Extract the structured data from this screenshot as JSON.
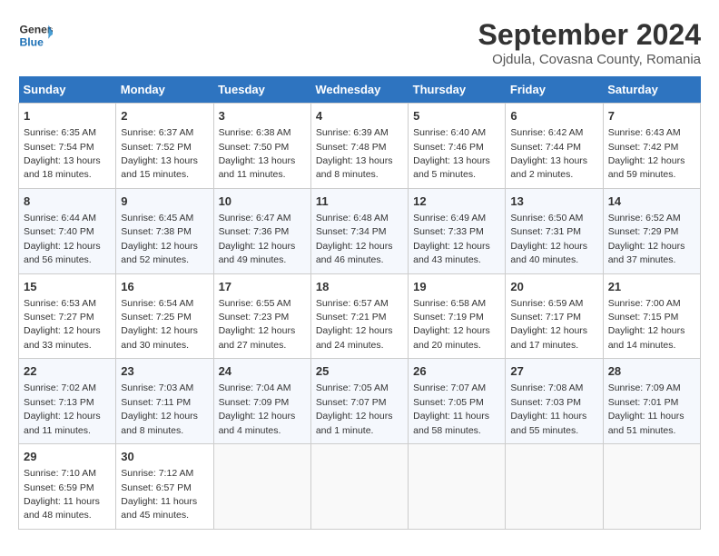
{
  "header": {
    "logo_line1": "General",
    "logo_line2": "Blue",
    "month": "September 2024",
    "location": "Ojdula, Covasna County, Romania"
  },
  "weekdays": [
    "Sunday",
    "Monday",
    "Tuesday",
    "Wednesday",
    "Thursday",
    "Friday",
    "Saturday"
  ],
  "weeks": [
    [
      {
        "num": "1",
        "sunrise": "6:35 AM",
        "sunset": "7:54 PM",
        "daylight": "13 hours and 18 minutes."
      },
      {
        "num": "2",
        "sunrise": "6:37 AM",
        "sunset": "7:52 PM",
        "daylight": "13 hours and 15 minutes."
      },
      {
        "num": "3",
        "sunrise": "6:38 AM",
        "sunset": "7:50 PM",
        "daylight": "13 hours and 11 minutes."
      },
      {
        "num": "4",
        "sunrise": "6:39 AM",
        "sunset": "7:48 PM",
        "daylight": "13 hours and 8 minutes."
      },
      {
        "num": "5",
        "sunrise": "6:40 AM",
        "sunset": "7:46 PM",
        "daylight": "13 hours and 5 minutes."
      },
      {
        "num": "6",
        "sunrise": "6:42 AM",
        "sunset": "7:44 PM",
        "daylight": "13 hours and 2 minutes."
      },
      {
        "num": "7",
        "sunrise": "6:43 AM",
        "sunset": "7:42 PM",
        "daylight": "12 hours and 59 minutes."
      }
    ],
    [
      {
        "num": "8",
        "sunrise": "6:44 AM",
        "sunset": "7:40 PM",
        "daylight": "12 hours and 56 minutes."
      },
      {
        "num": "9",
        "sunrise": "6:45 AM",
        "sunset": "7:38 PM",
        "daylight": "12 hours and 52 minutes."
      },
      {
        "num": "10",
        "sunrise": "6:47 AM",
        "sunset": "7:36 PM",
        "daylight": "12 hours and 49 minutes."
      },
      {
        "num": "11",
        "sunrise": "6:48 AM",
        "sunset": "7:34 PM",
        "daylight": "12 hours and 46 minutes."
      },
      {
        "num": "12",
        "sunrise": "6:49 AM",
        "sunset": "7:33 PM",
        "daylight": "12 hours and 43 minutes."
      },
      {
        "num": "13",
        "sunrise": "6:50 AM",
        "sunset": "7:31 PM",
        "daylight": "12 hours and 40 minutes."
      },
      {
        "num": "14",
        "sunrise": "6:52 AM",
        "sunset": "7:29 PM",
        "daylight": "12 hours and 37 minutes."
      }
    ],
    [
      {
        "num": "15",
        "sunrise": "6:53 AM",
        "sunset": "7:27 PM",
        "daylight": "12 hours and 33 minutes."
      },
      {
        "num": "16",
        "sunrise": "6:54 AM",
        "sunset": "7:25 PM",
        "daylight": "12 hours and 30 minutes."
      },
      {
        "num": "17",
        "sunrise": "6:55 AM",
        "sunset": "7:23 PM",
        "daylight": "12 hours and 27 minutes."
      },
      {
        "num": "18",
        "sunrise": "6:57 AM",
        "sunset": "7:21 PM",
        "daylight": "12 hours and 24 minutes."
      },
      {
        "num": "19",
        "sunrise": "6:58 AM",
        "sunset": "7:19 PM",
        "daylight": "12 hours and 20 minutes."
      },
      {
        "num": "20",
        "sunrise": "6:59 AM",
        "sunset": "7:17 PM",
        "daylight": "12 hours and 17 minutes."
      },
      {
        "num": "21",
        "sunrise": "7:00 AM",
        "sunset": "7:15 PM",
        "daylight": "12 hours and 14 minutes."
      }
    ],
    [
      {
        "num": "22",
        "sunrise": "7:02 AM",
        "sunset": "7:13 PM",
        "daylight": "12 hours and 11 minutes."
      },
      {
        "num": "23",
        "sunrise": "7:03 AM",
        "sunset": "7:11 PM",
        "daylight": "12 hours and 8 minutes."
      },
      {
        "num": "24",
        "sunrise": "7:04 AM",
        "sunset": "7:09 PM",
        "daylight": "12 hours and 4 minutes."
      },
      {
        "num": "25",
        "sunrise": "7:05 AM",
        "sunset": "7:07 PM",
        "daylight": "12 hours and 1 minute."
      },
      {
        "num": "26",
        "sunrise": "7:07 AM",
        "sunset": "7:05 PM",
        "daylight": "11 hours and 58 minutes."
      },
      {
        "num": "27",
        "sunrise": "7:08 AM",
        "sunset": "7:03 PM",
        "daylight": "11 hours and 55 minutes."
      },
      {
        "num": "28",
        "sunrise": "7:09 AM",
        "sunset": "7:01 PM",
        "daylight": "11 hours and 51 minutes."
      }
    ],
    [
      {
        "num": "29",
        "sunrise": "7:10 AM",
        "sunset": "6:59 PM",
        "daylight": "11 hours and 48 minutes."
      },
      {
        "num": "30",
        "sunrise": "7:12 AM",
        "sunset": "6:57 PM",
        "daylight": "11 hours and 45 minutes."
      },
      null,
      null,
      null,
      null,
      null
    ]
  ]
}
